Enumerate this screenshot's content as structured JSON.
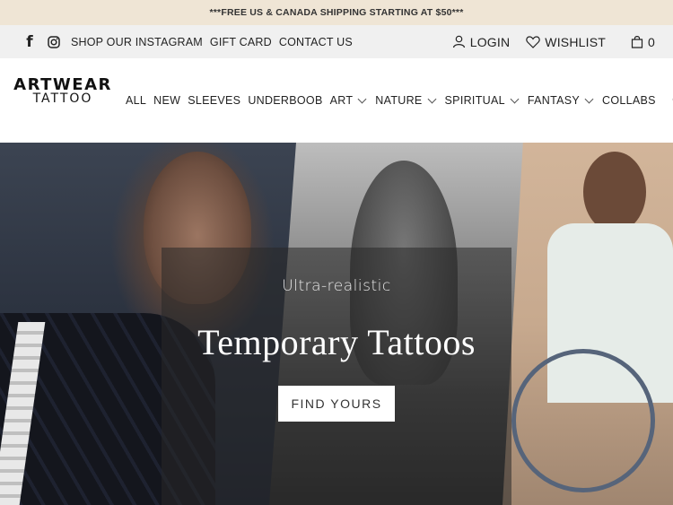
{
  "announcement": {
    "text": "***FREE US & CANADA SHIPPING STARTING AT $50***"
  },
  "topbar": {
    "social_icons": [
      "facebook-icon",
      "instagram-icon"
    ],
    "links": [
      "SHOP OUR INSTAGRAM",
      "GIFT CARD",
      "CONTACT US"
    ],
    "login_label": "LOGIN",
    "wishlist_label": "WISHLIST",
    "cart_count": "0"
  },
  "header": {
    "logo": {
      "line1": "ARTWEAR",
      "line2": "TATTOO"
    },
    "nav": [
      {
        "label": "ALL",
        "dropdown": false
      },
      {
        "label": "NEW",
        "dropdown": false
      },
      {
        "label": "SLEEVES",
        "dropdown": false
      },
      {
        "label": "UNDERBOOB",
        "dropdown": false
      },
      {
        "label": "ART",
        "dropdown": true
      },
      {
        "label": "NATURE",
        "dropdown": true
      },
      {
        "label": "SPIRITUAL",
        "dropdown": true
      },
      {
        "label": "FANTASY",
        "dropdown": true
      },
      {
        "label": "COLLABS",
        "dropdown": false
      }
    ],
    "search_icon": "search-icon"
  },
  "hero": {
    "subtitle": "Ultra-realistic",
    "title": "Temporary Tattoos",
    "cta_label": "FIND YOURS"
  },
  "colors": {
    "announcement_bg": "#efe5d5",
    "topbar_bg": "#f0f0f0",
    "text": "#222222"
  }
}
